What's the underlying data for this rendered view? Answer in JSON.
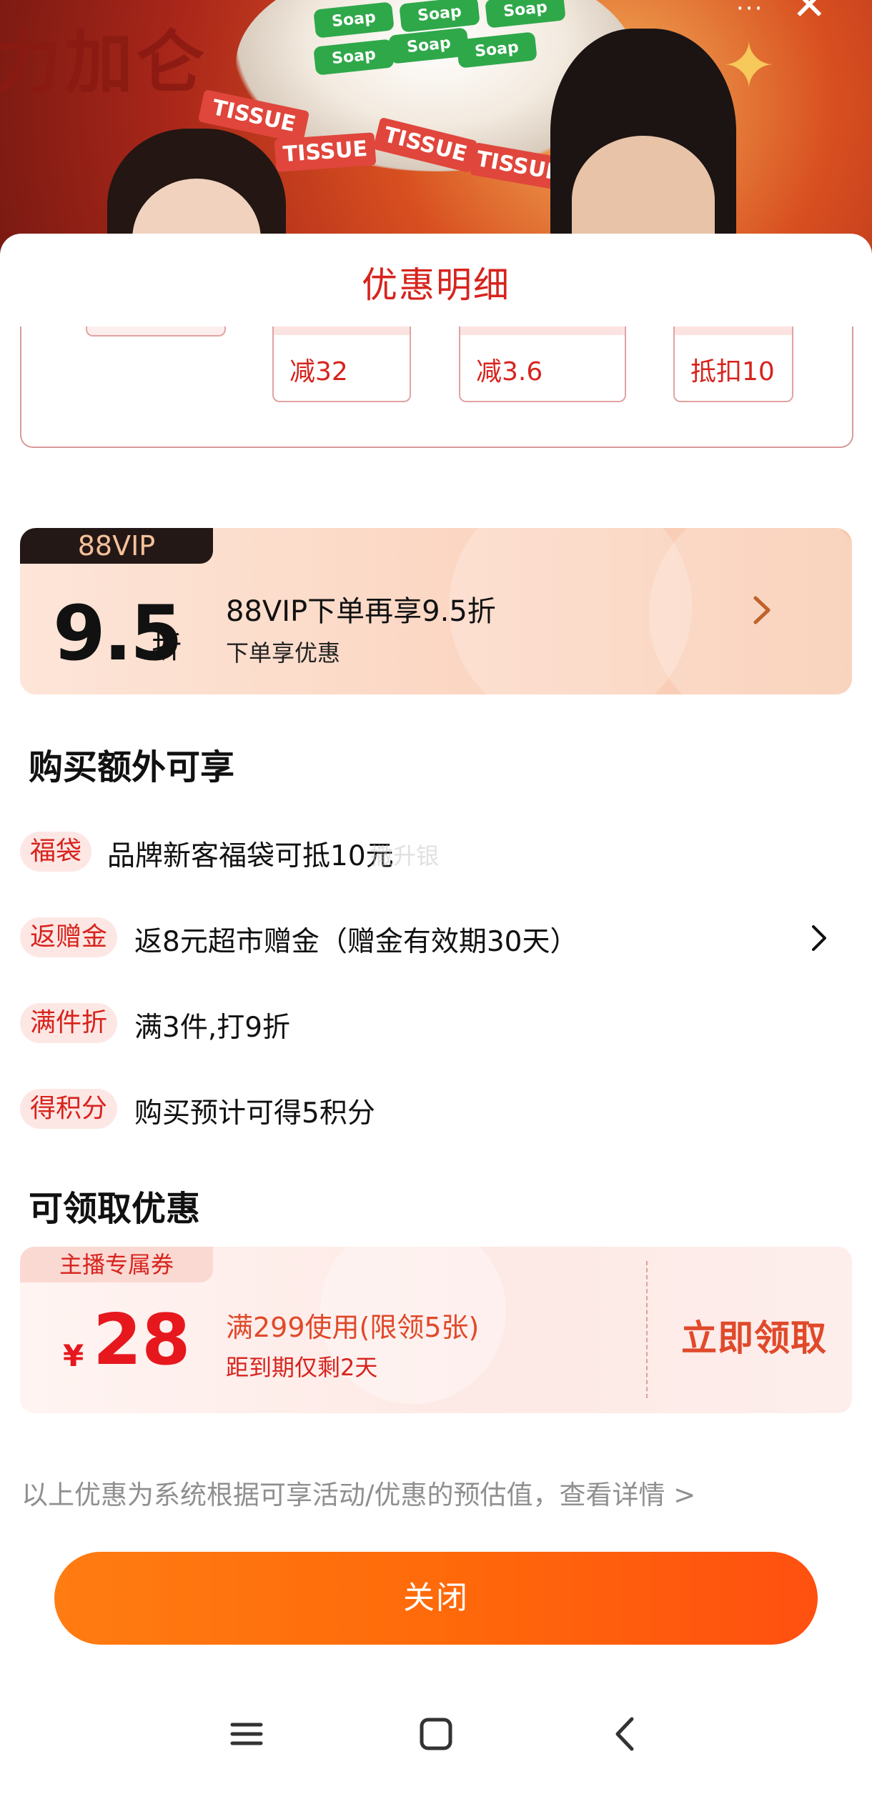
{
  "background": {
    "banner_text": "力加仑",
    "soap_labels": [
      "Soap",
      "Soap",
      "Soap",
      "Soap",
      "Soap",
      "Soap"
    ],
    "tissue_labels": [
      "TISSUE",
      "TISSUE",
      "TISSUE",
      "TISSUE"
    ],
    "more_icon": "···",
    "close_icon": "✕"
  },
  "sheet": {
    "title": "优惠明细"
  },
  "calc": {
    "chips": [
      "减32",
      "减3.6",
      "抵扣10"
    ]
  },
  "vip": {
    "tag": "88VIP",
    "discount_number": "9.5",
    "discount_unit": "折",
    "title": "88VIP下单再享9.5折",
    "subtitle": "下单享优惠"
  },
  "extra": {
    "section_title": "购买额外可享",
    "items": [
      {
        "tag": "福袋",
        "text": "品牌新客福袋可抵10元"
      },
      {
        "tag": "返赠金",
        "text": "返8元超市赠金（赠金有效期30天）"
      },
      {
        "tag": "满件折",
        "text": "满3件,打9折"
      },
      {
        "tag": "得积分",
        "text": "购买预计可得5积分"
      }
    ],
    "watermark": "撒升银"
  },
  "coupons": {
    "section_title": "可领取优惠",
    "tag": "主播专属券",
    "currency": "¥",
    "amount": "28",
    "condition": "满299使用(限领5张)",
    "expire": "距到期仅剩2天",
    "claim_label": "立即领取"
  },
  "footnote": "以上优惠为系统根据可享活动/优惠的预估值，查看详情 >",
  "close_label": "关闭",
  "colors": {
    "accent_red": "#d7231d",
    "coupon_red": "#e6181e",
    "orange_button": "#ff6a0a",
    "vip_dark": "#241816"
  }
}
